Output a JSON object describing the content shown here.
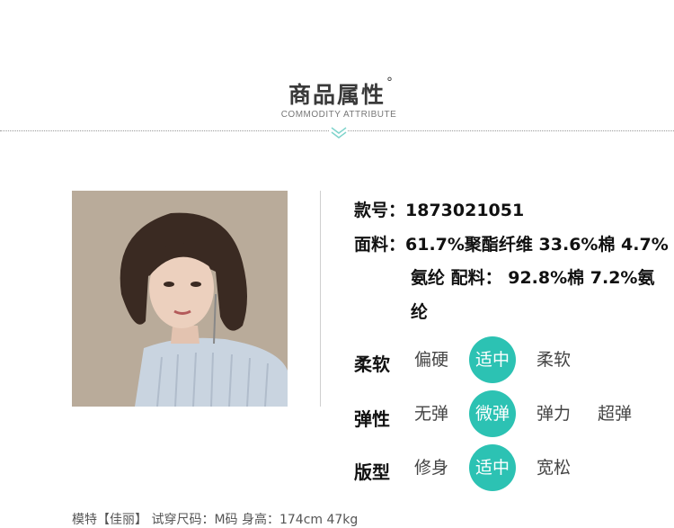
{
  "header": {
    "title": "商品属性",
    "title_mark": "°",
    "subtitle": "COMMODITY ATTRIBUTE"
  },
  "colors": {
    "accent": "#2cc2b3",
    "chevron": "#7fd4cc"
  },
  "info": {
    "style_no_line": "款号：1873021051",
    "fabric_line1": "面料：61.7%聚酯纤维 33.6%棉 4.7%",
    "fabric_line2": "氨纶 配料： 92.8%棉 7.2%氨",
    "fabric_line3": "纶"
  },
  "attributes": [
    {
      "label": "柔软",
      "options": [
        "偏硬",
        "适中",
        "柔软"
      ],
      "selected": "适中"
    },
    {
      "label": "弹性",
      "options": [
        "无弹",
        "微弹",
        "弹力",
        "超弹"
      ],
      "selected": "微弹"
    },
    {
      "label": "版型",
      "options": [
        "修身",
        "适中",
        "宽松"
      ],
      "selected": "适中"
    }
  ],
  "footer": {
    "model_note": "模特【佳丽】 试穿尺码：M码  身高：174cm 47kg"
  }
}
